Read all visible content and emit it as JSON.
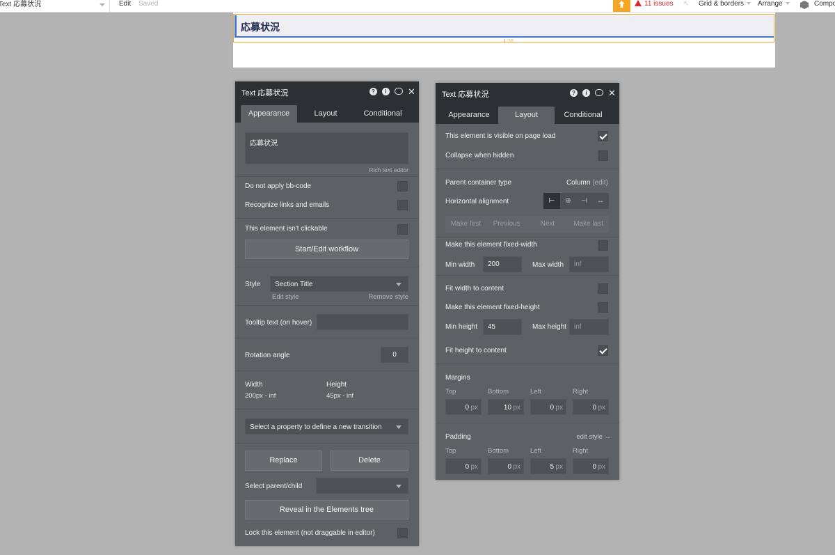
{
  "topbar": {
    "element_select": "Text 応募状況",
    "edit": "Edit",
    "saved": "Saved",
    "issues": "11 issues",
    "grid": "Grid & borders",
    "arrange": "Arrange",
    "components": "Compo"
  },
  "canvas": {
    "title_text": "応募状況",
    "margin_label": "10"
  },
  "left_panel": {
    "title": "Text 応募状況",
    "tabs": [
      "Appearance",
      "Layout",
      "Conditional"
    ],
    "active_tab": "Appearance",
    "content_text": "応募状況",
    "rich_text_editor": "Rich text editor",
    "no_bbcode": "Do not apply bb-code",
    "recognize_links": "Recognize links and emails",
    "not_clickable": "This element isn't clickable",
    "workflow_button": "Start/Edit workflow",
    "style_label": "Style",
    "style_value": "Section Title",
    "edit_style": "Edit style",
    "remove_style": "Remove style",
    "tooltip_label": "Tooltip text (on hover)",
    "rotation_label": "Rotation angle",
    "rotation_value": "0",
    "width_label": "Width",
    "width_value": "200px - inf",
    "height_label": "Height",
    "height_value": "45px - inf",
    "transition_placeholder": "Select a property to define a new transition",
    "replace_button": "Replace",
    "delete_button": "Delete",
    "parent_child_label": "Select parent/child",
    "reveal_button": "Reveal in the Elements tree",
    "lock_label": "Lock this element (not draggable in editor)"
  },
  "right_panel": {
    "title": "Text 応募状況",
    "tabs": [
      "Appearance",
      "Layout",
      "Conditional"
    ],
    "active_tab": "Layout",
    "visible_on_load": "This element is visible on page load",
    "collapse_hidden": "Collapse when hidden",
    "parent_container_label": "Parent container type",
    "parent_container_value": "Column",
    "parent_container_edit": "(edit)",
    "horizontal_alignment": "Horizontal alignment",
    "order_buttons": [
      "Make first",
      "Previous",
      "Next",
      "Make last"
    ],
    "fixed_width": "Make this element fixed-width",
    "min_width_label": "Min width",
    "min_width_value": "200",
    "max_width_label": "Max width",
    "max_width_placeholder": "inf",
    "fit_width": "Fit width to content",
    "fixed_height": "Make this element fixed-height",
    "min_height_label": "Min height",
    "min_height_value": "45",
    "max_height_label": "Max height",
    "max_height_placeholder": "inf",
    "fit_height": "Fit height to content",
    "margins_label": "Margins",
    "padding_label": "Padding",
    "edit_style_link": "edit style →",
    "side_labels": [
      "Top",
      "Bottom",
      "Left",
      "Right"
    ],
    "unit": "px",
    "margins_values": [
      "0",
      "10",
      "0",
      "0"
    ],
    "padding_values": [
      "0",
      "0",
      "5",
      "0"
    ]
  },
  "colors": {
    "accent": "#f5a623",
    "issues": "#e0262e",
    "selection_blue": "#3f79cf",
    "panel_bg": "#5e6164",
    "panel_header": "#2d3032"
  }
}
